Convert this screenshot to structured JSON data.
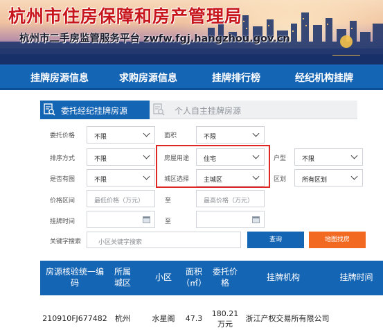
{
  "header": {
    "title": "杭州市住房保障和房产管理局",
    "subtitle": "杭州市二手房监管服务平台 zwfw.fgj.hangzhou.gov.cn"
  },
  "nav": {
    "items": [
      "挂牌房源信息",
      "求购房源信息",
      "挂牌排行榜",
      "经纪机构挂牌"
    ]
  },
  "tabs": {
    "active": "委托经纪挂牌房源",
    "inactive": "个人自主挂牌房源"
  },
  "filters": {
    "price": {
      "label": "委托价格",
      "value": "不限"
    },
    "area": {
      "label": "面积",
      "value": "不限"
    },
    "sort": {
      "label": "排序方式",
      "value": "不限"
    },
    "usage": {
      "label": "房屋用途",
      "value": "住宅"
    },
    "layout": {
      "label": "户型",
      "value": "不限"
    },
    "has_image": {
      "label": "是否有图",
      "value": "不限"
    },
    "district": {
      "label": "城区选择",
      "value": "主城区"
    },
    "zone": {
      "label": "区划",
      "value": "所有区划"
    },
    "price_range": {
      "label": "价格区间",
      "min_placeholder": "最低价格（万元）",
      "to": "至",
      "max_placeholder": "最高价格（万元）"
    },
    "list_time": {
      "label": "挂牌时间",
      "to": "至"
    },
    "keyword": {
      "label": "关键字搜索",
      "placeholder": "小区关键字搜索"
    },
    "query_button": "查询",
    "map_button": "地图找房"
  },
  "table": {
    "headers": {
      "id": "房源核验统一编码",
      "district": "所属城区",
      "community": "小区",
      "area": "面积（㎡）",
      "price": "委托价格",
      "agency": "挂牌机构",
      "time": "挂牌时间"
    },
    "rows": [
      {
        "id": "210910FJ677482",
        "district": "杭州",
        "community": "水星阁",
        "area": "47.3",
        "price": "180.21万元",
        "agency": "浙江产权交易所有限公司",
        "time": ""
      }
    ]
  },
  "colors": {
    "primary": "#1565b5",
    "accent": "#f26a21",
    "highlight": "#e02525",
    "title_red": "#c8161d"
  }
}
